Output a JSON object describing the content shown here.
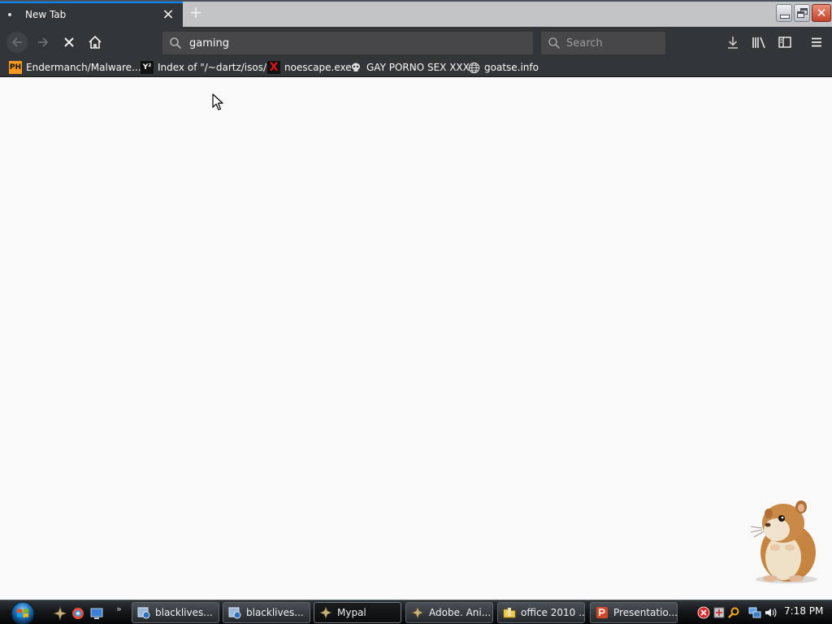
{
  "browser": {
    "tab": {
      "title": "New Tab",
      "close_glyph": "×"
    },
    "new_tab_glyph": "+",
    "window_controls": {
      "close_glyph": "✕"
    },
    "nav": {
      "back": "back-arrow-icon",
      "forward": "forward-arrow-icon",
      "stop": "stop-icon",
      "home": "home-icon"
    },
    "url_bar": {
      "value": "gaming"
    },
    "search_bar": {
      "placeholder": "Search"
    },
    "toolbar_icons": [
      "download-icon",
      "library-icon",
      "sidebar-icon",
      "hamburger-menu-icon"
    ],
    "bookmarks": [
      {
        "label": "Endermanch/Malware...",
        "icon_text": "PH"
      },
      {
        "label": "Index of \"/~dartz/isos/\"",
        "icon_text": "Y²"
      },
      {
        "label": "noescape.exe",
        "icon_text": "X"
      },
      {
        "label": "GAY PORNO SEX XXX",
        "icon_text": ""
      },
      {
        "label": "goatse.info",
        "icon_text": ""
      }
    ]
  },
  "taskbar": {
    "more_glyph": "»",
    "tasks": [
      {
        "label": "blacklives..."
      },
      {
        "label": "blacklives..."
      },
      {
        "label": "Mypal"
      },
      {
        "label": "Adobe. Ani..."
      },
      {
        "label": "office 2010 ..."
      },
      {
        "label": "Presentatio..."
      }
    ],
    "clock": "7:18 PM"
  },
  "colors": {
    "toolbar_bg": "#323639",
    "tab_accent": "#0a84ff",
    "page_bg": "#f9f9fa",
    "taskbar_bg": "#0b0d0e"
  }
}
